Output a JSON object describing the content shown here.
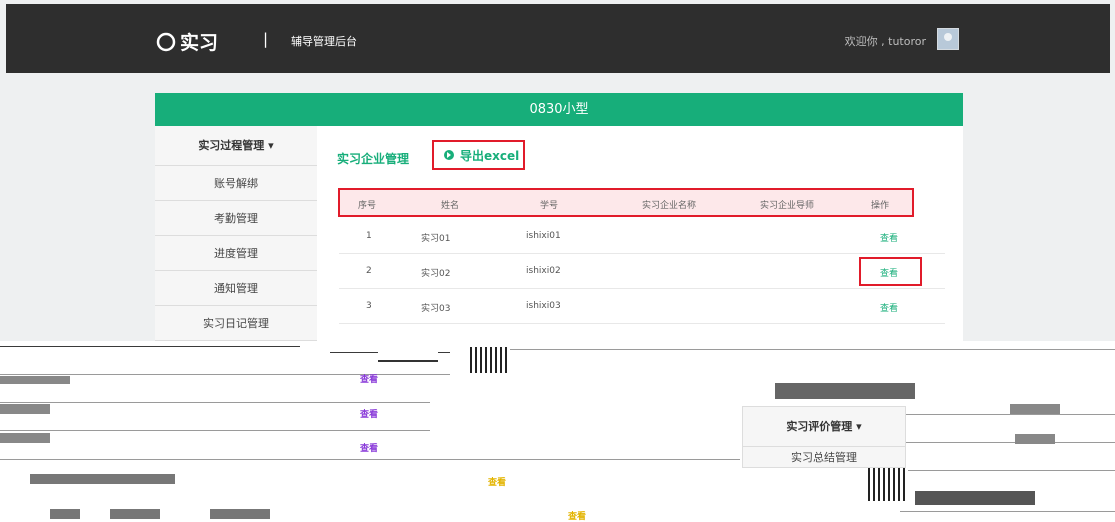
{
  "header": {
    "logo_text": "实习",
    "separator": "|",
    "app_title": "辅导管理后台",
    "welcome": "欢迎你 , tutoror"
  },
  "page_title": "0830小型",
  "sidebar": {
    "heading": "实习过程管理 ▾",
    "items": [
      {
        "label": "账号解绑"
      },
      {
        "label": "考勤管理"
      },
      {
        "label": "进度管理"
      },
      {
        "label": "通知管理"
      },
      {
        "label": "实习日记管理"
      }
    ]
  },
  "main": {
    "section_title": "实习企业管理",
    "export_label": "导出excel",
    "columns": [
      "序号",
      "姓名",
      "学号",
      "实习企业名称",
      "实习企业导师",
      "操作"
    ],
    "rows": [
      {
        "no": "1",
        "name": "实习01",
        "id": "ishixi01",
        "company": "",
        "mentor": "",
        "action": "查看"
      },
      {
        "no": "2",
        "name": "实习02",
        "id": "ishixi02",
        "company": "",
        "mentor": "",
        "action": "查看"
      },
      {
        "no": "3",
        "name": "实习03",
        "id": "ishixi03",
        "company": "",
        "mentor": "",
        "action": "查看"
      }
    ]
  },
  "glitch": {
    "purple_links": [
      "查看",
      "查看",
      "查看"
    ],
    "yellow_links": [
      "查看",
      "查看"
    ],
    "menu_heading": "实习评价管理 ▾",
    "menu_item": "实习总结管理"
  }
}
